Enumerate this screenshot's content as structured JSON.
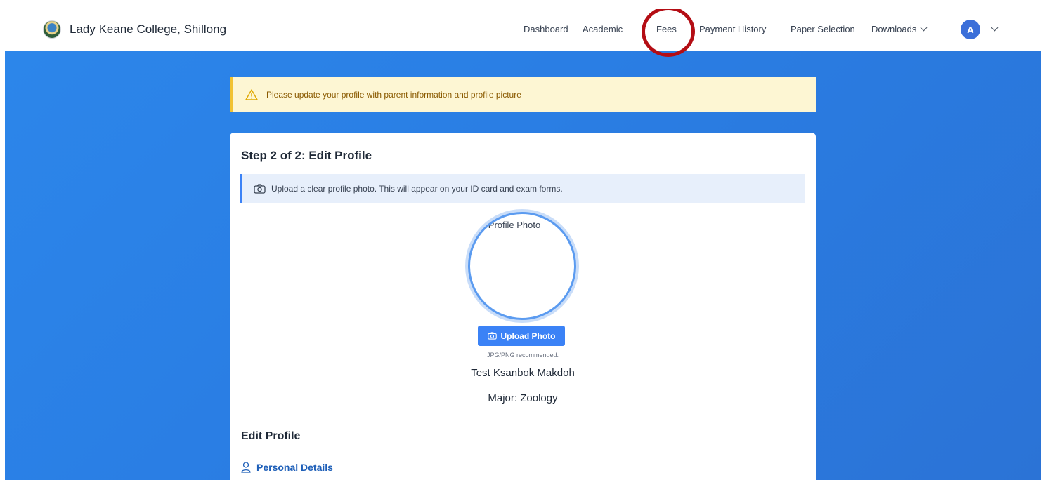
{
  "header": {
    "college_name": "Lady Keane College, Shillong",
    "nav": [
      {
        "label": "Dashboard"
      },
      {
        "label": "Academic"
      },
      {
        "label": "Fees"
      },
      {
        "label": "Payment History"
      },
      {
        "label": "Paper Selection"
      },
      {
        "label": "Downloads"
      }
    ],
    "avatar_initial": "A"
  },
  "alert": {
    "text": "Please update your profile with parent information and profile picture"
  },
  "card": {
    "step_title": "Step 2 of 2: Edit Profile",
    "info_text": "Upload a clear profile photo. This will appear on your ID card and exam forms.",
    "photo_alt": "Profile Photo",
    "upload_label": "Upload Photo",
    "hint": "JPG/PNG recommended.",
    "student_name": "Test Ksanbok Makdoh",
    "major": "Major: Zoology",
    "edit_title": "Edit Profile",
    "personal_details": "Personal Details"
  },
  "colors": {
    "accent": "#3b82f6",
    "background": "#2a7ee4",
    "highlight_circle": "#b40d14",
    "alert_bg": "#fdf6d3"
  }
}
